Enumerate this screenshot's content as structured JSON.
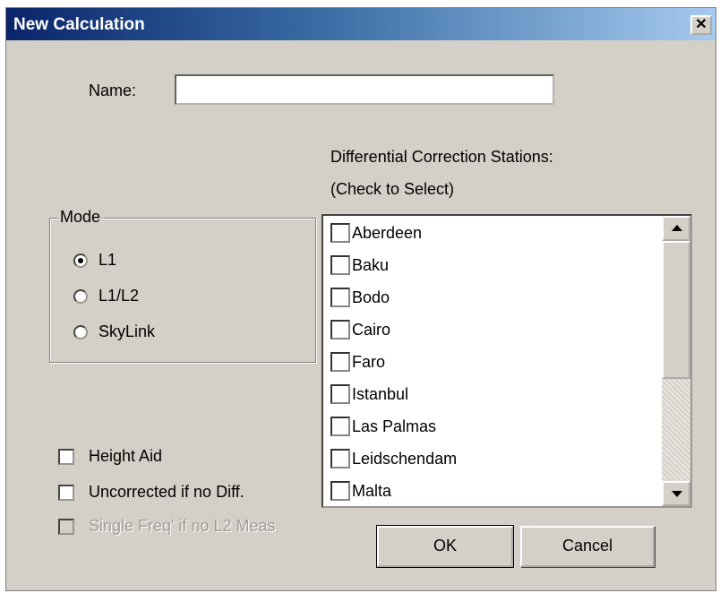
{
  "window": {
    "title": "New Calculation",
    "close_glyph": "✕"
  },
  "name_field": {
    "label": "Name:",
    "value": ""
  },
  "stations_header": {
    "line1": "Differential Correction Stations:",
    "line2": "(Check to Select)"
  },
  "mode": {
    "legend": "Mode",
    "options": [
      {
        "label": "L1",
        "selected": true
      },
      {
        "label": "L1/L2",
        "selected": false
      },
      {
        "label": "SkyLink",
        "selected": false
      }
    ]
  },
  "options": [
    {
      "label": "Height Aid",
      "checked": false,
      "enabled": true
    },
    {
      "label": "Uncorrected if no Diff.",
      "checked": false,
      "enabled": true
    },
    {
      "label": "Single Freq' if no L2 Meas",
      "checked": false,
      "enabled": false
    }
  ],
  "stations": [
    {
      "label": "Aberdeen",
      "checked": false
    },
    {
      "label": "Baku",
      "checked": false
    },
    {
      "label": "Bodo",
      "checked": false
    },
    {
      "label": "Cairo",
      "checked": false
    },
    {
      "label": "Faro",
      "checked": false
    },
    {
      "label": "Istanbul",
      "checked": false
    },
    {
      "label": "Las Palmas",
      "checked": false
    },
    {
      "label": "Leidschendam",
      "checked": false
    },
    {
      "label": "Malta",
      "checked": false
    }
  ],
  "buttons": {
    "ok": "OK",
    "cancel": "Cancel"
  },
  "icons": {
    "scroll_up": "scroll-up-arrow-icon",
    "scroll_down": "scroll-down-arrow-icon",
    "close": "close-icon"
  }
}
